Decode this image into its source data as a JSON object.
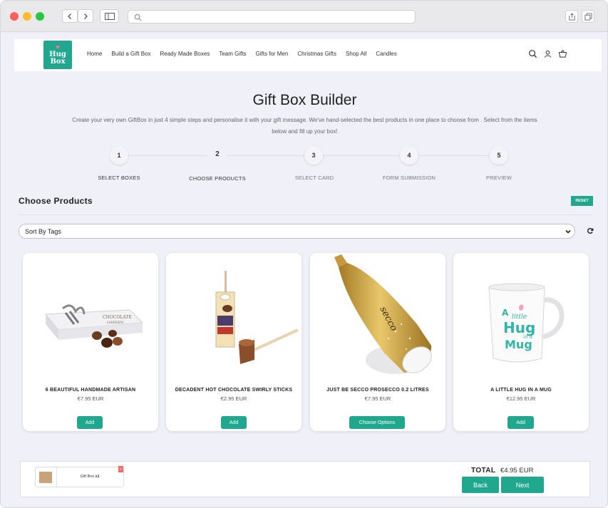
{
  "header": {
    "logo_line1": "Hug",
    "logo_line2": "Box",
    "menu": [
      "Home",
      "Build a Gift Box",
      "Ready Made Boxes",
      "Team Gifts",
      "Gifts for Men",
      "Christmas Gifts",
      "Shop All",
      "Candles"
    ]
  },
  "page": {
    "title": "Gift Box Builder",
    "subtitle": "Create your very own GiftBox in just 4 simple steps and personalise it with your gift message. We've hand-selected the best products in one place to choose from . Select from the items below and fill up your box!"
  },
  "steps": [
    {
      "num": "1",
      "label": "SELECT BOXES"
    },
    {
      "num": "2",
      "label": "CHOOSE PRODUCTS",
      "active": true
    },
    {
      "num": "3",
      "label": "SELECT CARD"
    },
    {
      "num": "4",
      "label": "FORM SUBMISSION"
    },
    {
      "num": "5",
      "label": "PREVIEW"
    }
  ],
  "section": {
    "title": "Choose Products",
    "reset_label": "RESET",
    "sort_value": "Sort By Tags"
  },
  "products": [
    {
      "name": "6 BEAUTIFUL HANDMADE ARTISAN",
      "price": "€7.95 EUR",
      "button": "Add"
    },
    {
      "name": "DECADENT HOT CHOCOLATE SWIRLY STICKS",
      "price": "€2.95 EUR",
      "button": "Add"
    },
    {
      "name": "JUST BE SECCO PROSECCO 0.2 LITRES",
      "price": "€7.95 EUR",
      "button": "Choose Options"
    },
    {
      "name": "A LITTLE HUG IN A MUG",
      "price": "€12.95 EUR",
      "button": "Add"
    }
  ],
  "product_images": {
    "box_text_1": "CHOCOLATE",
    "box_text_2": "GARDEN",
    "bottle_text": "secco",
    "mug_text_1": "A",
    "mug_text_2": "little",
    "mug_text_3": "Hug",
    "mug_text_4": "in a",
    "mug_text_5": "Mug"
  },
  "footer": {
    "cart_item": "Gift Box",
    "cart_qty": "x1",
    "remove": "x",
    "total_label": "TOTAL",
    "total_value": "€4.95 EUR",
    "back_label": "Back",
    "next_label": "Next"
  },
  "colors": {
    "accent": "#1fa88e",
    "page_bg": "#f0f0f8",
    "remove": "#f26a6a"
  }
}
